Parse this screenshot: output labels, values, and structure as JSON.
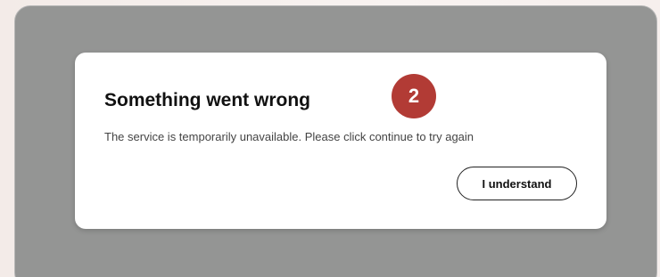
{
  "dialog": {
    "title": "Something went wrong",
    "message": "The service is temporarily unavailable. Please click continue to try again",
    "badge": "2",
    "confirm_label": "I understand"
  },
  "colors": {
    "overlay": "#949594",
    "badge": "#b23b35",
    "dialog_background": "#ffffff"
  }
}
